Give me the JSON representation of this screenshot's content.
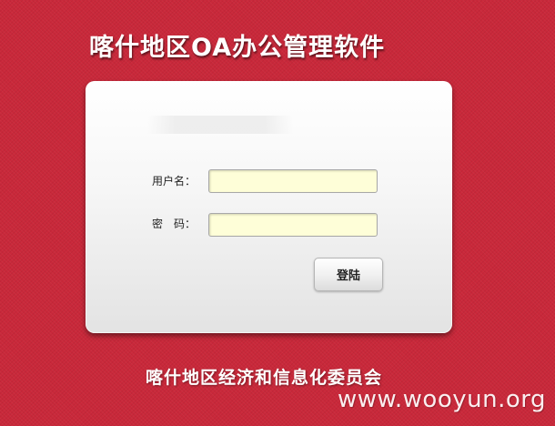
{
  "header": {
    "title": "喀什地区OA办公管理软件"
  },
  "login": {
    "username_label": "用户名：",
    "username_value": "",
    "password_label": "密　码：",
    "password_value": "",
    "submit_label": "登陆"
  },
  "footer": {
    "organization": "喀什地区经济和信息化委员会"
  },
  "watermark": {
    "text": "www.wooyun.org"
  },
  "colors": {
    "background": "#c9283a",
    "panel": "#f2f2f2",
    "input_background": "#fefed8",
    "text_light": "#ffffff"
  }
}
